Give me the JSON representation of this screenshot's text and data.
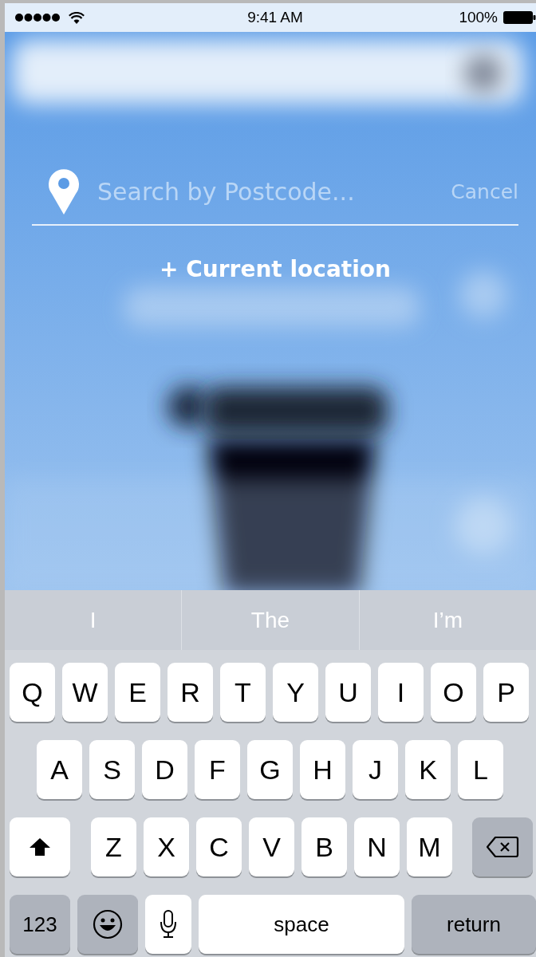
{
  "status_bar": {
    "time": "9:41 AM",
    "battery": "100%"
  },
  "search": {
    "placeholder": "Search by Postcode...",
    "cancel": "Cancel"
  },
  "current_location": "+ Current location",
  "suggestions": [
    "I",
    "The",
    "I’m"
  ],
  "keyboard": [
    [
      {
        "kind": "letter",
        "label": "Q"
      },
      {
        "kind": "letter",
        "label": "W"
      },
      {
        "kind": "letter",
        "label": "E"
      },
      {
        "kind": "letter",
        "label": "R"
      },
      {
        "kind": "letter",
        "label": "T"
      },
      {
        "kind": "letter",
        "label": "Y"
      },
      {
        "kind": "letter",
        "label": "U"
      },
      {
        "kind": "letter",
        "label": "I"
      },
      {
        "kind": "letter",
        "label": "O"
      },
      {
        "kind": "letter",
        "label": "P"
      }
    ],
    [
      {
        "kind": "letter",
        "label": "A"
      },
      {
        "kind": "letter",
        "label": "S"
      },
      {
        "kind": "letter",
        "label": "D"
      },
      {
        "kind": "letter",
        "label": "F"
      },
      {
        "kind": "letter",
        "label": "G"
      },
      {
        "kind": "letter",
        "label": "H"
      },
      {
        "kind": "letter",
        "label": "J"
      },
      {
        "kind": "letter",
        "label": "K"
      },
      {
        "kind": "letter",
        "label": "L"
      }
    ],
    [
      {
        "kind": "shift"
      },
      {
        "kind": "letter",
        "label": "Z"
      },
      {
        "kind": "letter",
        "label": "X"
      },
      {
        "kind": "letter",
        "label": "C"
      },
      {
        "kind": "letter",
        "label": "V"
      },
      {
        "kind": "letter",
        "label": "B"
      },
      {
        "kind": "letter",
        "label": "N"
      },
      {
        "kind": "letter",
        "label": "M"
      },
      {
        "kind": "delete"
      }
    ],
    [
      {
        "kind": "numbers",
        "label": "123"
      },
      {
        "kind": "emoji"
      },
      {
        "kind": "mic"
      },
      {
        "kind": "space",
        "label": "space"
      },
      {
        "kind": "return",
        "label": "return"
      }
    ]
  ]
}
